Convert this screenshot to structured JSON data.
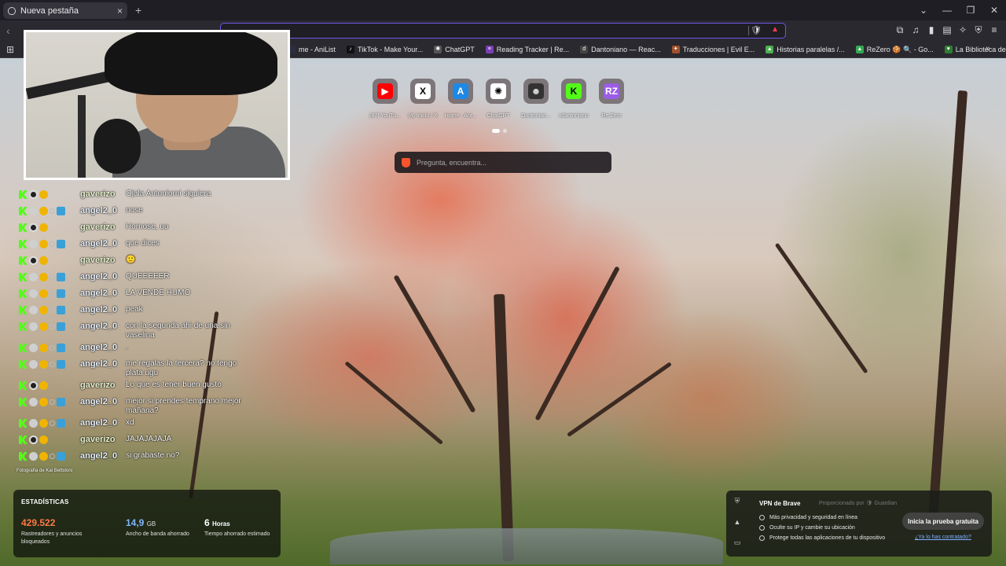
{
  "tab": {
    "title": "Nueva pestaña",
    "close": "×",
    "new": "+"
  },
  "window_controls": [
    "⌄",
    "—",
    "❐",
    "✕"
  ],
  "nav": {
    "back": "‹"
  },
  "bookmarks": [
    {
      "label": "me - AniList",
      "color": "#2b2d42",
      "glyph": ""
    },
    {
      "label": "TikTok - Make Your...",
      "color": "#111",
      "glyph": "♪"
    },
    {
      "label": "ChatGPT",
      "color": "#555",
      "glyph": "✺"
    },
    {
      "label": "Reading Tracker | Re...",
      "color": "#7b3fb5",
      "glyph": "≡"
    },
    {
      "label": "Dantoniano — Reac...",
      "color": "#444",
      "glyph": "d"
    },
    {
      "label": "Traducciones | Evil E...",
      "color": "#a0522d",
      "glyph": "✦"
    },
    {
      "label": "Historias paralelas /...",
      "color": "#4caf50",
      "glyph": "▲"
    },
    {
      "label": "ReZero 🍪 🔍 - Go...",
      "color": "#34a853",
      "glyph": "▲"
    },
    {
      "label": "La Biblioteca de Ech...",
      "color": "#2e7d32",
      "glyph": "♥"
    }
  ],
  "tiles": [
    {
      "label": "(47) YouTu...",
      "color": "#ff0000",
      "glyph": "▶",
      "fg": "#fff"
    },
    {
      "label": "(4) Inicio / X",
      "color": "#fff",
      "glyph": "X",
      "fg": "#000"
    },
    {
      "label": "Home - Ani...",
      "color": "#1e88e5",
      "glyph": "A",
      "fg": "#fff"
    },
    {
      "label": "ChatGPT",
      "color": "#fff",
      "glyph": "✺",
      "fg": "#000"
    },
    {
      "label": "Dantonian...",
      "color": "#333",
      "glyph": "☻",
      "fg": "#ddd"
    },
    {
      "label": "xdantoniano",
      "color": "#53fc18",
      "glyph": "K",
      "fg": "#000"
    },
    {
      "label": "Re:Zero",
      "color": "#9b5de5",
      "glyph": "RZ",
      "fg": "#fff"
    }
  ],
  "search": {
    "placeholder": "Pregunta, encuentra..."
  },
  "chat": [
    {
      "user": "gaverizo",
      "type": "g",
      "text": "Ojala Antoniorni siguiera"
    },
    {
      "user": "angel2_0",
      "type": "a",
      "text": "nose"
    },
    {
      "user": "gaverizo",
      "type": "g",
      "text": "Hornose, uu"
    },
    {
      "user": "angel2_0",
      "type": "a",
      "text": "que dices"
    },
    {
      "user": "gaverizo",
      "type": "g",
      "text": "🙂"
    },
    {
      "user": "angel2_0",
      "type": "a",
      "text": "QUEEEEER"
    },
    {
      "user": "angel2_0",
      "type": "a",
      "text": "LA VENDE HUMO"
    },
    {
      "user": "angel2_0",
      "type": "a",
      "text": "peak"
    },
    {
      "user": "angel2_0",
      "type": "a",
      "text": "con la segunda ahi de una sin vaselina"
    },
    {
      "user": "angel2_0",
      "type": "a",
      "text": "."
    },
    {
      "user": "angel2_0",
      "type": "a",
      "text": "me regalas la tercera? no tengo plata ugu"
    },
    {
      "user": "gaverizo",
      "type": "g",
      "text": "Lo que es tener buen gusto"
    },
    {
      "user": "angel2_0",
      "type": "a",
      "text": "mejor si prendes temprano mejor mañana?"
    },
    {
      "user": "angel2_0",
      "type": "a",
      "text": "xd"
    },
    {
      "user": "gaverizo",
      "type": "g",
      "text": "JAJAJAJAJA"
    },
    {
      "user": "angel2_0",
      "type": "a",
      "text": "si grabaste no?"
    }
  ],
  "photo_credit": "Fotografía de Kai Bettstoni",
  "stats": {
    "title": "ESTADÍSTICAS",
    "blocked": {
      "value": "429.522",
      "unit": "",
      "label": "Rastreadores y anuncios bloqueados"
    },
    "bandwidth": {
      "value": "14,9",
      "unit": "GB",
      "label": "Ancho de banda ahorrado"
    },
    "time": {
      "value": "6",
      "unit": "Horas",
      "label": "Tiempo ahorrado estimado"
    }
  },
  "vpn": {
    "title": "VPN de Brave",
    "by": "Proporcionado por 🛡 Guardian",
    "features": [
      "Más privacidad y seguridad en línea",
      "Oculte su IP y cambie su ubicación",
      "Protege todas las aplicaciones de tu dispositivo"
    ],
    "cta": "Inicia la prueba gratuita",
    "link": "¿Ya lo has contratado?"
  }
}
